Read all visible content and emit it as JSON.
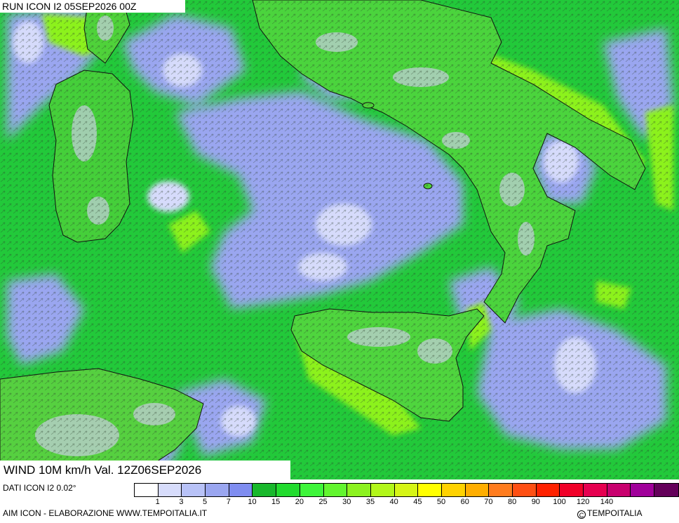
{
  "header": {
    "run_title": "RUN ICON I2 05SEP2026 00Z"
  },
  "map": {
    "variable_title": "WIND 10M km/h Val. 12Z06SEP2026",
    "land_outline_color": "#111111",
    "calm_color": "#9aa6f0",
    "moderate_color": "#22c93a",
    "fresh_color": "#7cf21c"
  },
  "footer": {
    "dati": "DATI ICON I2 0.02°",
    "credit": "AIM ICON - ELABORAZIONE WWW.TEMPOITALIA.IT",
    "copyright": "TEMPOITALIA",
    "copyright_symbol": "C"
  },
  "legend": {
    "colors": [
      "#ffffff",
      "#d7dcfb",
      "#b8c2f7",
      "#9aa6f0",
      "#7f8df0",
      "#19b82c",
      "#22db2e",
      "#3ef53a",
      "#62f52f",
      "#8cf21f",
      "#b2f71a",
      "#d6f516",
      "#ffff00",
      "#ffd200",
      "#ffae00",
      "#ff7c1e",
      "#ff5014",
      "#ff2200",
      "#f00028",
      "#e60050",
      "#c8006e",
      "#a0009a",
      "#64005a"
    ],
    "labels": [
      "1",
      "3",
      "5",
      "7",
      "10",
      "15",
      "20",
      "25",
      "30",
      "35",
      "40",
      "45",
      "50",
      "60",
      "70",
      "80",
      "90",
      "100",
      "120",
      "140"
    ]
  }
}
